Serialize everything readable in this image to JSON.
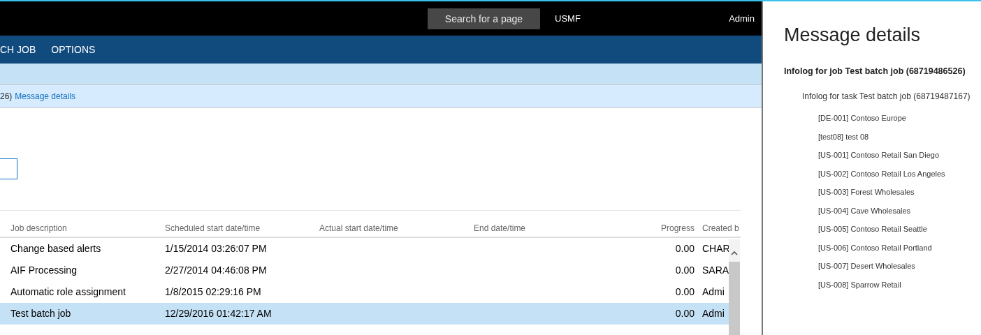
{
  "top_bar": {
    "search": {
      "placeholder": "Search for a page"
    },
    "company": "USMF",
    "user": "Admin"
  },
  "action_pane": [
    {
      "label": "CH JOB"
    },
    {
      "label": "OPTIONS"
    }
  ],
  "message_bar": {
    "text": "26)",
    "link": "Message details"
  },
  "grid": {
    "columns": [
      "Job description",
      "Scheduled start date/time",
      "Actual start date/time",
      "End date/time",
      "Progress",
      "Created b"
    ],
    "rows": [
      {
        "cells": [
          "Change based alerts",
          "1/15/2014 03:26:07 PM",
          "",
          "",
          "0.00",
          "CHAR"
        ],
        "selected": false
      },
      {
        "cells": [
          "AIF Processing",
          "2/27/2014 04:46:08 PM",
          "",
          "",
          "0.00",
          "SARA"
        ],
        "selected": false
      },
      {
        "cells": [
          "Automatic role assignment",
          "1/8/2015 02:29:16 PM",
          "",
          "",
          "0.00",
          "Admi"
        ],
        "selected": false
      },
      {
        "cells": [
          "Test batch job",
          "12/29/2016 01:42:17 AM",
          "",
          "",
          "0.00",
          "Admi"
        ],
        "selected": true
      }
    ]
  },
  "message_panel": {
    "title": "Message details",
    "entries": [
      {
        "text": "Infolog for job Test batch job (68719486526)",
        "children": [
          {
            "text": "Infolog for task Test batch job (68719487167)",
            "children": [
              {
                "text": "[DE-001] Contoso Europe"
              },
              {
                "text": "[test08] test 08"
              },
              {
                "text": "[US-001] Contoso Retail San Diego"
              },
              {
                "text": "[US-002] Contoso Retail Los Angeles"
              },
              {
                "text": "[US-003] Forest Wholesales"
              },
              {
                "text": "[US-004] Cave Wholesales"
              },
              {
                "text": "[US-005] Contoso Retail Seattle"
              },
              {
                "text": "[US-006] Contoso Retail Portland"
              },
              {
                "text": "[US-007] Desert Wholesales"
              },
              {
                "text": "[US-008] Sparrow Retail"
              }
            ]
          }
        ]
      }
    ]
  }
}
